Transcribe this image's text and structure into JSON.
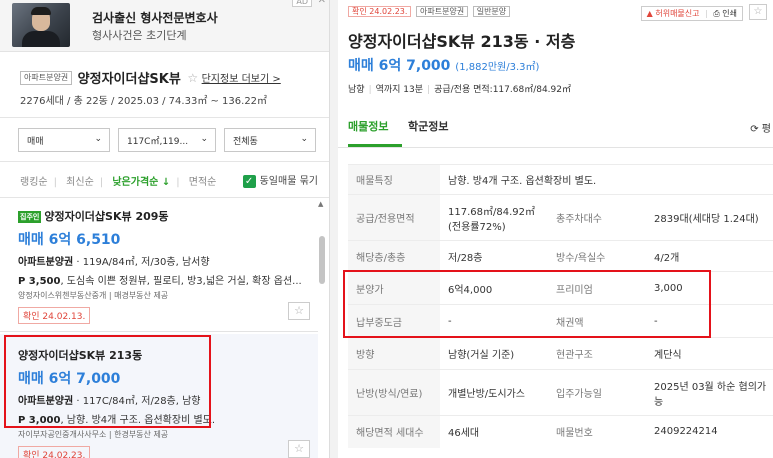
{
  "ad": {
    "badge": "AD",
    "close": "✕",
    "title": "검사출신 형사전문변호사",
    "subtitle": "형사사건은 초기단계"
  },
  "complex": {
    "tag": "아파트분양권",
    "name": "양정자이더샵SK뷰",
    "star": "☆",
    "more_link": "단지정보 더보기 >",
    "stats": "2276세대 / 총 22동 / 2025.03 / 74.33㎡ ~ 136.22㎡"
  },
  "filters": {
    "trade_type": "매매",
    "area": "117C㎡,119...",
    "dong": "전체동",
    "caret": "⌄"
  },
  "sort": {
    "ranking": "랭킹순",
    "latest": "최신순",
    "low_price": "낮은가격순 ↓",
    "area": "면적순",
    "same_listing": "동일매물 묶기",
    "check": "✓"
  },
  "listings": [
    {
      "tag": "집주인",
      "title": "양정자이더샵SK뷰 209동",
      "price": "매매 6억 6,510",
      "spec_bold": "아파트분양권",
      "spec_rest": " · 119A/84㎡, 저/30층, 남서향",
      "desc_bold": "P 3,500",
      "desc_rest": ", 도심속 이쁜 정원뷰, 필로티, 방3,넓은 거실, 확장 옵션...",
      "agent": "양정자이스위첸부동산중개 | 매경부동산 제공",
      "date": "확인 24.02.13.",
      "fav": "☆"
    },
    {
      "title": "양정자이더샵SK뷰 213동",
      "price": "매매 6억 7,000",
      "spec_bold": "아파트분양권",
      "spec_rest": " · 117C/84㎡, 저/28층, 남향",
      "desc_bold": "P 3,000",
      "desc_rest": ", 남향. 방4개 구조. 옵션확장비 별도.",
      "agent": "자이부자공인중개사사무소 | 한경부동산 제공",
      "date": "확인 24.02.23.",
      "fav": "☆"
    }
  ],
  "scrollbar": {
    "up": "▲"
  },
  "detail": {
    "date": "확인 24.02.23.",
    "tag1": "아파트분양권",
    "tag2": "일반분양",
    "report": "허위매물신고",
    "print": "인쇄",
    "star": "☆",
    "title": "양정자이더샵SK뷰 213동 · 저층",
    "price": "매매 6억 7,000",
    "price_per": "(1,882만원/3.3㎡)",
    "direction": "남향",
    "station": "역까지 13분",
    "area": "공급/전용 면적:117.68㎡/84.92㎡",
    "tab_listing": "매물정보",
    "tab_school": "학군정보",
    "tab_right": "⟳ 평",
    "rows": [
      {
        "k1": "매물특징",
        "v1": "남향. 방4개 구조. 옵션확장비 별도.",
        "k2": "",
        "v2": ""
      },
      {
        "k1": "공급/전용면적",
        "v1": "117.68㎡/84.92㎡(전용률72%)",
        "k2": "총주차대수",
        "v2": "2839대(세대당 1.24대)"
      },
      {
        "k1": "해당층/총층",
        "v1": "저/28층",
        "k2": "방수/욕실수",
        "v2": "4/2개"
      },
      {
        "k1": "분양가",
        "v1": "6억4,000",
        "k2": "프리미엄",
        "v2": "3,000"
      },
      {
        "k1": "납부중도금",
        "v1": "-",
        "k2": "채권액",
        "v2": "-"
      },
      {
        "k1": "방향",
        "v1": "남향(거실 기준)",
        "k2": "현관구조",
        "v2": "계단식"
      },
      {
        "k1": "난방(방식/연료)",
        "v1": "개별난방/도시가스",
        "k2": "입주가능일",
        "v2": "2025년 03월 하순 협의가능"
      },
      {
        "k1": "해당면적 세대수",
        "v1": "46세대",
        "k2": "매물번호",
        "v2": "2409224214"
      }
    ]
  }
}
